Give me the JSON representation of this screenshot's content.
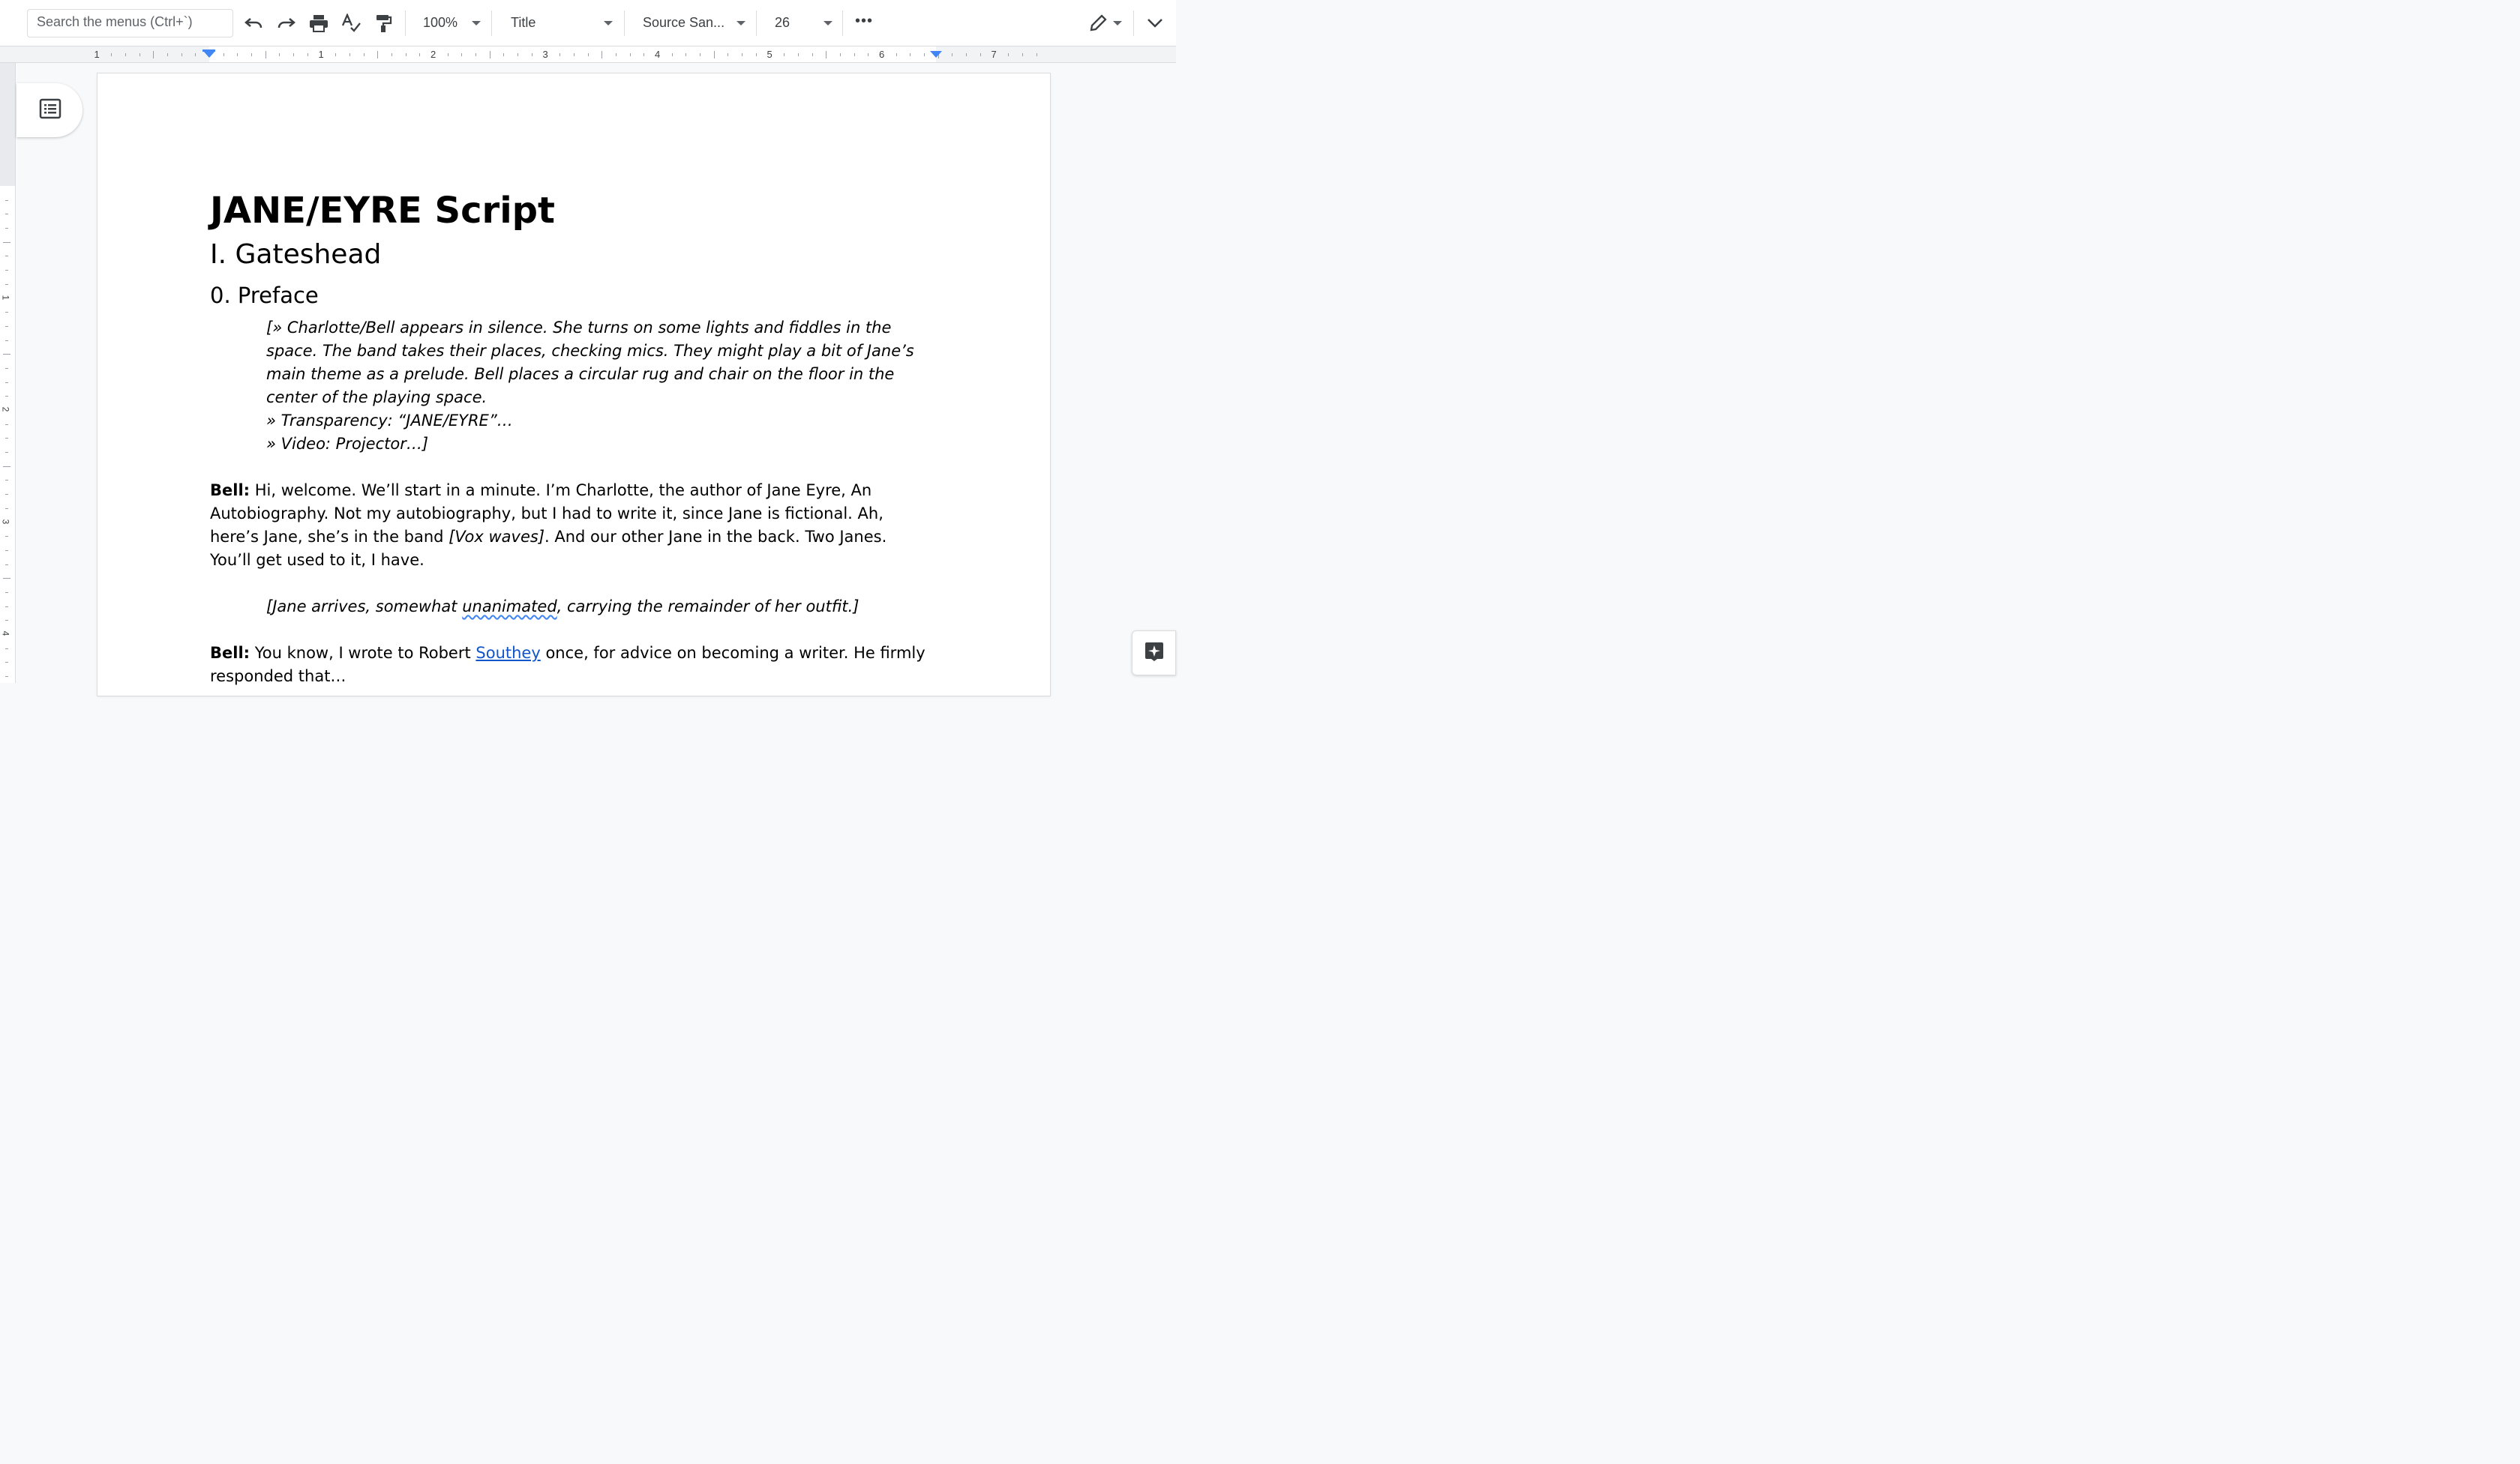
{
  "toolbar": {
    "search_placeholder": "Search the menus (Ctrl+`)",
    "zoom": "100%",
    "style": "Title",
    "font": "Source San...",
    "font_size": "26",
    "more": "•••"
  },
  "ruler": {
    "h_labels": [
      "1",
      "1",
      "2",
      "3",
      "4",
      "5",
      "6",
      "7"
    ],
    "v_labels": [
      "1",
      "2",
      "3",
      "4"
    ]
  },
  "document": {
    "title": "JANE/EYRE Script",
    "heading1": "I. Gateshead",
    "heading2": "0. Preface",
    "stage1_line1": "[» Charlotte/Bell appears in silence. She turns on some lights and fiddles in the space. The band takes their places, checking mics. They might play a bit of Jane’s main theme as a prelude. Bell places a circular rug and chair on the floor in the center of the playing space.",
    "stage1_line2": "» Transparency: “JANE/EYRE”…",
    "stage1_line3": "» Video: Projector…]",
    "para1_speaker": "Bell:",
    "para1_text_a": " Hi, welcome. We’ll start in a minute. I’m Charlotte, the author of Jane Eyre, An Autobiography. Not my autobiography, but I had to write it, since Jane is fictional. Ah, here’s Jane, she’s in the band ",
    "para1_italic": "[Vox waves]",
    "para1_text_b": ". And our other Jane in the back. Two Janes. You’ll get used to it, I have.",
    "stage2_a": "[Jane arrives, somewhat ",
    "stage2_misspelled": "unanimated",
    "stage2_b": ", carrying the remainder of her outfit.]",
    "para2_speaker": "Bell:",
    "para2_text_a": " You know, I wrote to Robert ",
    "para2_link": "Southey",
    "para2_text_b": " once, for advice on becoming a writer. He firmly responded that…"
  },
  "colors": {
    "accent": "#4285f4",
    "link": "#1155cc"
  },
  "icons": [
    "undo-icon",
    "redo-icon",
    "print-icon",
    "spellcheck-icon",
    "paint-format-icon",
    "pencil-icon",
    "chevron-down-icon",
    "outline-icon",
    "explore-icon"
  ]
}
